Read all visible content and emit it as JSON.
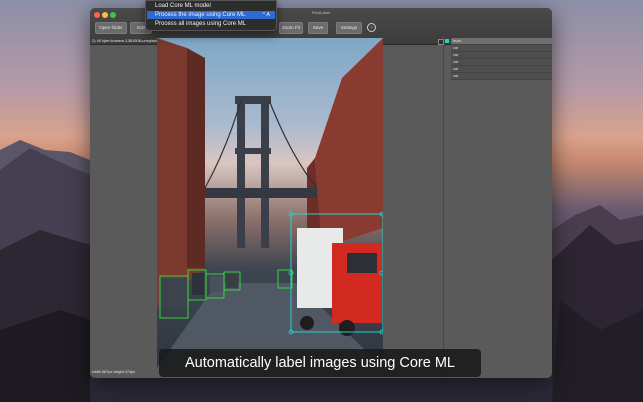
{
  "menu": {
    "items": [
      {
        "label": "Load Core ML model",
        "shortcut": ""
      },
      {
        "label": "Process the image using Core ML",
        "shortcut": "^ A"
      },
      {
        "label": "Process all images using Core ML",
        "shortcut": ""
      }
    ]
  },
  "window": {
    "title": "RectLabel",
    "toolbar": {
      "open_folder": "Open folder",
      "edit": "Edit",
      "zoom_fit": "Zoom Fit",
      "save": "Save",
      "settings": "Settings",
      "help": "?"
    },
    "filename": "2) 40 tyler-bowers-1381908-unsplash.jpg",
    "status": "width 587px height 474px"
  },
  "labels": [
    {
      "name": "truck",
      "checked": true,
      "color": "#2ad0cc"
    },
    {
      "name": "car"
    },
    {
      "name": "car"
    },
    {
      "name": "car"
    },
    {
      "name": "car"
    },
    {
      "name": "car"
    }
  ],
  "colors": {
    "truck_box": "#2ad0cc",
    "car_box": "#3adf3a",
    "menu_highlight": "#2f6ad1"
  },
  "caption": "Automatically label images using Core ML"
}
